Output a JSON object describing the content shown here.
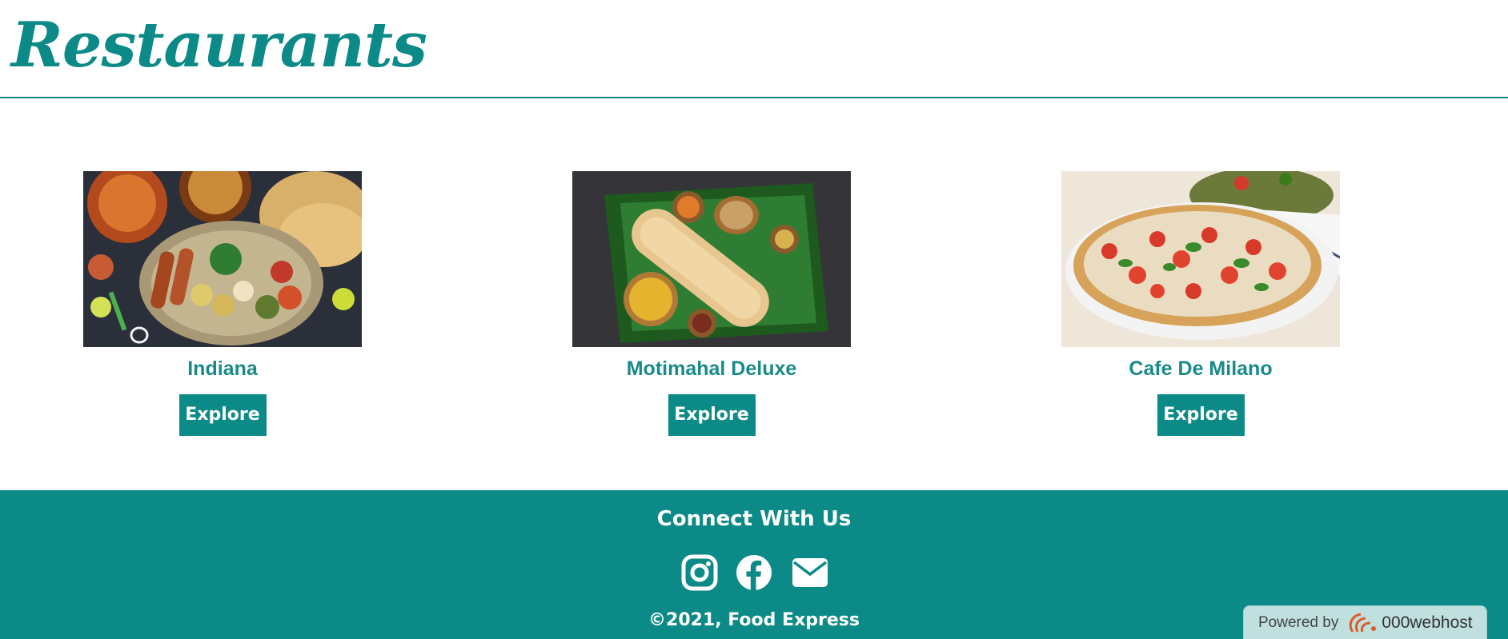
{
  "header": {
    "title": "Restaurants"
  },
  "restaurants": [
    {
      "name": "Indiana",
      "button": "Explore",
      "image": "indian-food-platter"
    },
    {
      "name": "Motimahal Deluxe",
      "button": "Explore",
      "image": "dosa-banana-leaf"
    },
    {
      "name": "Cafe De Milano",
      "button": "Explore",
      "image": "margherita-pizza"
    }
  ],
  "footer": {
    "title": "Connect With Us",
    "social": [
      "instagram-icon",
      "facebook-icon",
      "mail-icon"
    ],
    "copyright": "©2021, Food Express"
  },
  "badge": {
    "powered_by": "Powered by",
    "host": "000webhost"
  },
  "colors": {
    "accent": "#0b8a87",
    "name_text": "#198a8a",
    "badge_bg": "#bfe0df"
  }
}
